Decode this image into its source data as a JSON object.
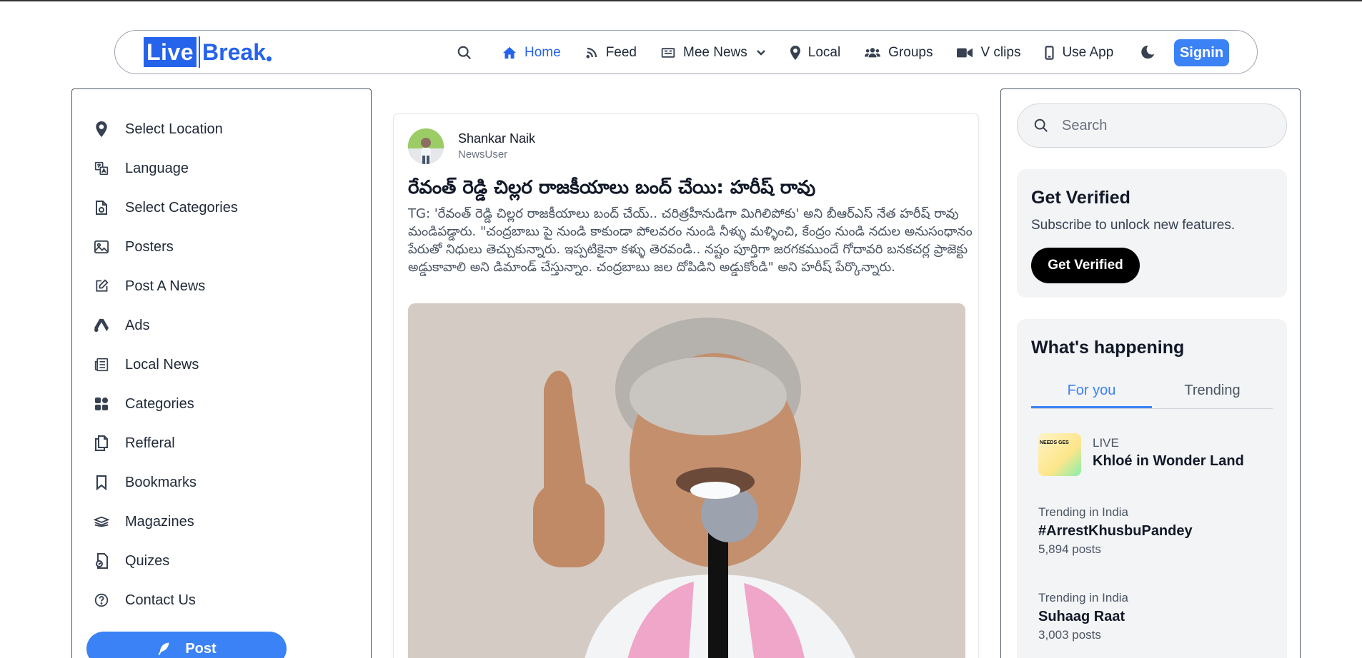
{
  "header": {
    "logo_left": "Live",
    "logo_right": "Break",
    "nav": [
      {
        "label": "Home",
        "icon": "home-icon"
      },
      {
        "label": "Feed",
        "icon": "rss-icon"
      },
      {
        "label": "Mee News",
        "icon": "newspaper-icon"
      },
      {
        "label": "Local",
        "icon": "map-pin-icon"
      },
      {
        "label": "Groups",
        "icon": "users-icon"
      },
      {
        "label": "V clips",
        "icon": "video-icon"
      },
      {
        "label": "Use App",
        "icon": "mobile-icon"
      }
    ],
    "signin_label": "Signin"
  },
  "sidebar": {
    "items": [
      {
        "label": "Select Location",
        "icon": "map-pin-icon"
      },
      {
        "label": "Language",
        "icon": "language-icon"
      },
      {
        "label": "Select Categories",
        "icon": "file-icon"
      },
      {
        "label": "Posters",
        "icon": "image-icon"
      },
      {
        "label": "Post A News",
        "icon": "edit-icon"
      },
      {
        "label": "Ads",
        "icon": "ads-icon"
      },
      {
        "label": "Local News",
        "icon": "newspaper-icon"
      },
      {
        "label": "Categories",
        "icon": "grid-icon"
      },
      {
        "label": "Refferal",
        "icon": "copy-icon"
      },
      {
        "label": "Bookmarks",
        "icon": "bookmark-icon"
      },
      {
        "label": "Magazines",
        "icon": "layers-icon"
      },
      {
        "label": "Quizes",
        "icon": "quiz-icon"
      },
      {
        "label": "Contact Us",
        "icon": "help-icon"
      }
    ],
    "post_label": "Post"
  },
  "post": {
    "author": "Shankar Naik",
    "role": "NewsUser",
    "title": "రేవంత్ రెడ్డి చిల్లర రాజకీయాలు బంద్ చేయి: హరీష్ రావు",
    "body": "TG: 'రేవంత్ రెడ్డి చిల్లర రాజకీయాలు బంద్ చేయ్.. చరిత్రహీనుడిగా మిగిలిపోకు' అని బీఆర్ఎస్ నేత హరీష్ రావు మండిపడ్డారు. \"చంద్రబాబు పై నుండి కాకుండా పోలవరం నుండి నీళ్ళు మళ్ళించి, కేంద్రం నుండి నదుల అనుసంధానం పేరుతో నిధులు తెచ్చుకున్నారు. ఇప్పటికైనా కళ్ళు తెరవండి.. నష్టం పూర్తిగా జరగకముందే గోదావరి బనకచర్ల ప్రాజెక్టు అడ్డుకావాలి అని డిమాండ్ చేస్తున్నాం. చంద్రబాబు జల దోపిడిని అడ్డుకోండి\" అని హరీష్ పేర్కొన్నారు."
  },
  "right": {
    "search_placeholder": "Search",
    "verify": {
      "title": "Get Verified",
      "subtitle": "Subscribe to unlock new features.",
      "button": "Get Verified"
    },
    "happening": {
      "title": "What's happening",
      "tabs": [
        "For you",
        "Trending"
      ],
      "live": {
        "label": "LIVE",
        "title": "Khloé in Wonder Land",
        "thumb_text": "NEEDS GES"
      },
      "trends": [
        {
          "meta": "Trending in India",
          "tag": "#ArrestKhusbuPandey",
          "count": "5,894 posts"
        },
        {
          "meta": "Trending in India",
          "tag": "Suhaag Raat",
          "count": "3,003 posts"
        }
      ]
    }
  },
  "colors": {
    "accent": "#3b82f6",
    "brand": "#2563eb"
  }
}
